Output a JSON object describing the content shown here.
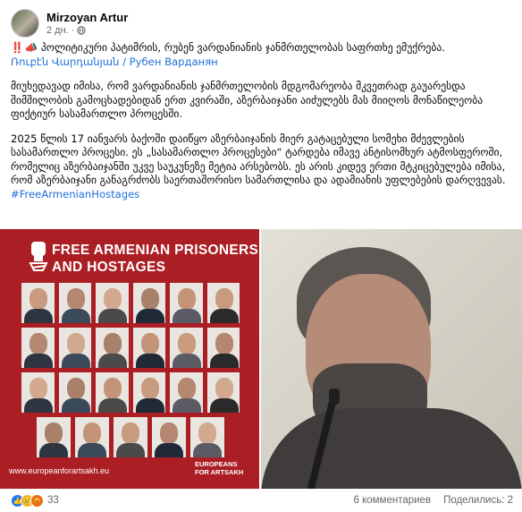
{
  "post": {
    "author": "Mirzoyan Artur",
    "time": "2 дн.",
    "privacy_icon": "globe-icon",
    "alert_icons": "‼️",
    "title_line": "პოლიტიკური პატიმრის, რუბენ ვარდანიანის ჯანმრთელობას საფრთხე ემუქრება.",
    "names_line": "Ռուբէն Վարդանյան / Рубен Варданян",
    "paragraph_1": "მიუხედავად იმისა, რომ ვარდანიანის ჯანმრთელობის მდგომარეობა მკვეთრად გაუარესდა შიმშილობის გამოცხადებიდან ერთ კვირაში, აზერბაიჯანი აიძულებს მას მიიღოს მონაწილეობა ფიქტიურ სასამართლო პროცესში.",
    "paragraph_2": "2025 წლის 17 იანვარს ბაქოში დაიწყო აზერბაიჯანის მიერ გატაცებული სომეხი მძევლების სასამართლო პროცესი. ეს „სასამართლო პროცესები“ ტარდება იმავე ანტისომხურ ატმოსფეროში, რომელიც აზერბაიჯანში უკვე საუკუნეზე მეტია არსებობს. ეს არის კიდევ ერთი მტკიცებულება იმისა, რომ აზერბაიჯანი განაგრძობს საერთაშორისო სამართლისა და ადამიანის უფლებების დარღვევას.",
    "hashtag": "#FreeArmenianHostages"
  },
  "poster": {
    "title_line_1": "FREE ARMENIAN PRISONERS",
    "title_line_2": "AND HOSTAGES",
    "url": "www.europeanforartsakh.eu",
    "brand_line_1": "EUROPEANS",
    "brand_line_2": "FOR ARTSAKH",
    "rows": [
      6,
      6,
      6,
      5
    ],
    "bg_color": "#ab1e24"
  },
  "footer": {
    "reaction_icons": [
      "like-icon",
      "sad-icon",
      "angry-icon"
    ],
    "reaction_count": "33",
    "comments": "6 комментариев",
    "shares": "Поделились: 2"
  }
}
